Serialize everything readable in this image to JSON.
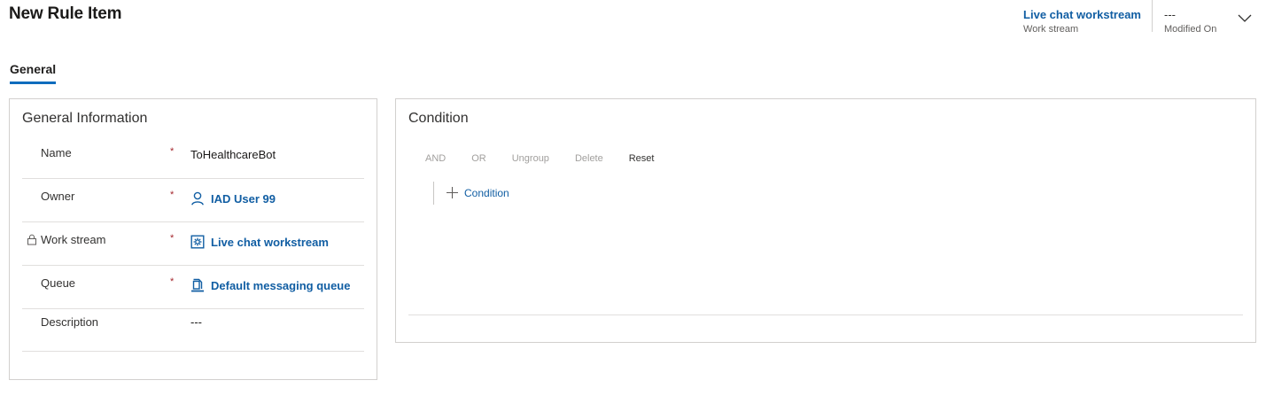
{
  "page": {
    "title": "New Rule Item"
  },
  "header": {
    "workstream": {
      "value": "Live chat workstream",
      "label": "Work stream"
    },
    "modified_on": {
      "value": "---",
      "label": "Modified On"
    },
    "expand_icon": "chevron-down-icon"
  },
  "tabs": [
    {
      "label": "General",
      "selected": true
    }
  ],
  "general_info": {
    "title": "General Information",
    "fields": [
      {
        "label": "Name",
        "required": "*",
        "value": "ToHealthcareBot"
      },
      {
        "label": "Owner",
        "required": "*",
        "value": "IAD User 99",
        "icon": "user-icon"
      },
      {
        "label": "Work stream",
        "required": "*",
        "value": "Live chat workstream",
        "icon": "workstream-icon",
        "locked": true
      },
      {
        "label": "Queue",
        "required": "*",
        "value": "Default messaging queue",
        "icon": "queue-icon"
      },
      {
        "label": "Description",
        "value": "---"
      }
    ]
  },
  "condition": {
    "title": "Condition",
    "toolbar": [
      {
        "label": "AND",
        "enabled": false
      },
      {
        "label": "OR",
        "enabled": false
      },
      {
        "label": "Ungroup",
        "enabled": false
      },
      {
        "label": "Delete",
        "enabled": false
      },
      {
        "label": "Reset",
        "enabled": true
      }
    ],
    "add_label": "Condition"
  },
  "colors": {
    "accent": "#0f6cbd",
    "link": "#115ea3",
    "required": "#a4262c",
    "border": "#d2d0ce"
  }
}
